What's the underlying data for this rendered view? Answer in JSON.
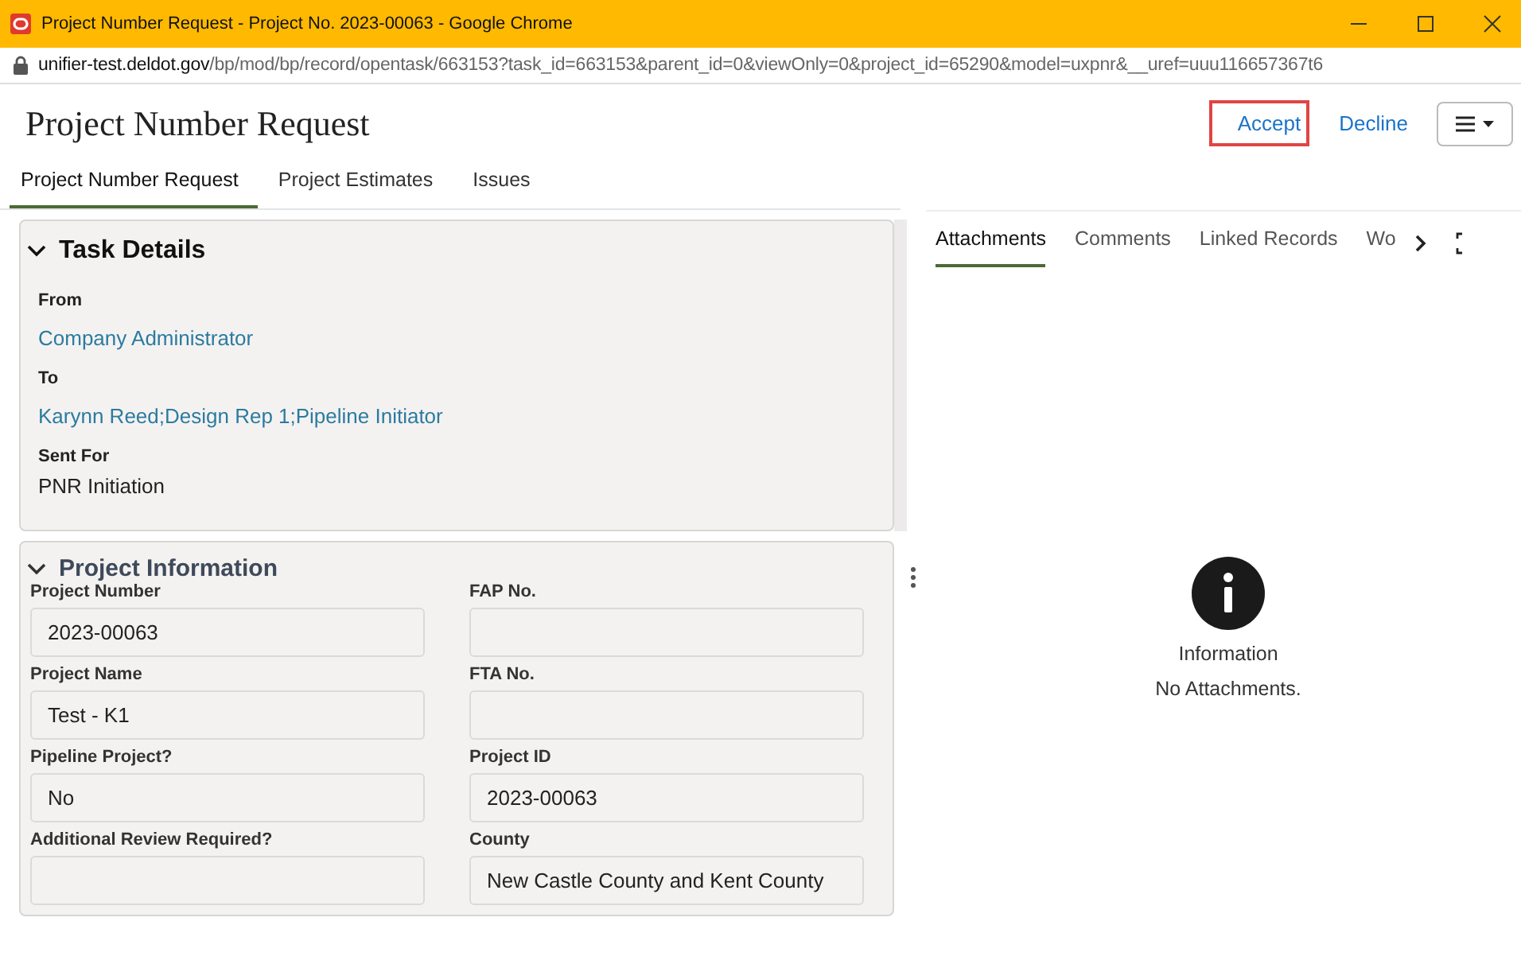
{
  "window": {
    "title": "Project Number Request - Project No. 2023-00063 - Google Chrome"
  },
  "address_bar": {
    "host": "unifier-test.deldot.gov",
    "path": "/bp/mod/bp/record/opentask/663153?task_id=663153&parent_id=0&viewOnly=0&project_id=65290&model=uxpnr&__uref=uuu116657367t6"
  },
  "header": {
    "title": "Project Number Request",
    "actions": [
      {
        "label": "Accept",
        "highlighted": true
      },
      {
        "label": "Decline",
        "highlighted": false
      }
    ]
  },
  "tabs": [
    {
      "label": "Project Number Request",
      "selected": true
    },
    {
      "label": "Project Estimates",
      "selected": false
    },
    {
      "label": "Issues",
      "selected": false
    }
  ],
  "task_details": {
    "title": "Task Details",
    "expanded": true,
    "items": [
      {
        "label": "From",
        "value": "Company Administrator",
        "kind": "link"
      },
      {
        "label": "To",
        "value": "Karynn Reed;Design Rep 1;Pipeline Initiator",
        "kind": "link"
      },
      {
        "label": "Sent For",
        "value": "PNR Initiation",
        "kind": "text"
      }
    ]
  },
  "project_information": {
    "title": "Project Information",
    "expanded": true,
    "fields": [
      {
        "label": "Project Number",
        "value": "2023-00063"
      },
      {
        "label": "FAP No."
      },
      {
        "label": "Project Name",
        "value": "Test - K1"
      },
      {
        "label": "FTA No."
      },
      {
        "label": "Pipeline Project?",
        "value": "No"
      },
      {
        "label": "Project ID",
        "value": "2023-00063"
      },
      {
        "label": "Additional Review Required?"
      },
      {
        "label": "County",
        "value": "New Castle County and Kent County"
      }
    ]
  },
  "side_panel": {
    "tabs": [
      {
        "label": "Attachments",
        "selected": true
      },
      {
        "label": "Comments",
        "selected": false
      },
      {
        "label": "Linked Records",
        "selected": false
      },
      {
        "label": "Wo",
        "selected": false
      }
    ],
    "empty_state": {
      "title": "Information",
      "message": "No Attachments."
    }
  }
}
